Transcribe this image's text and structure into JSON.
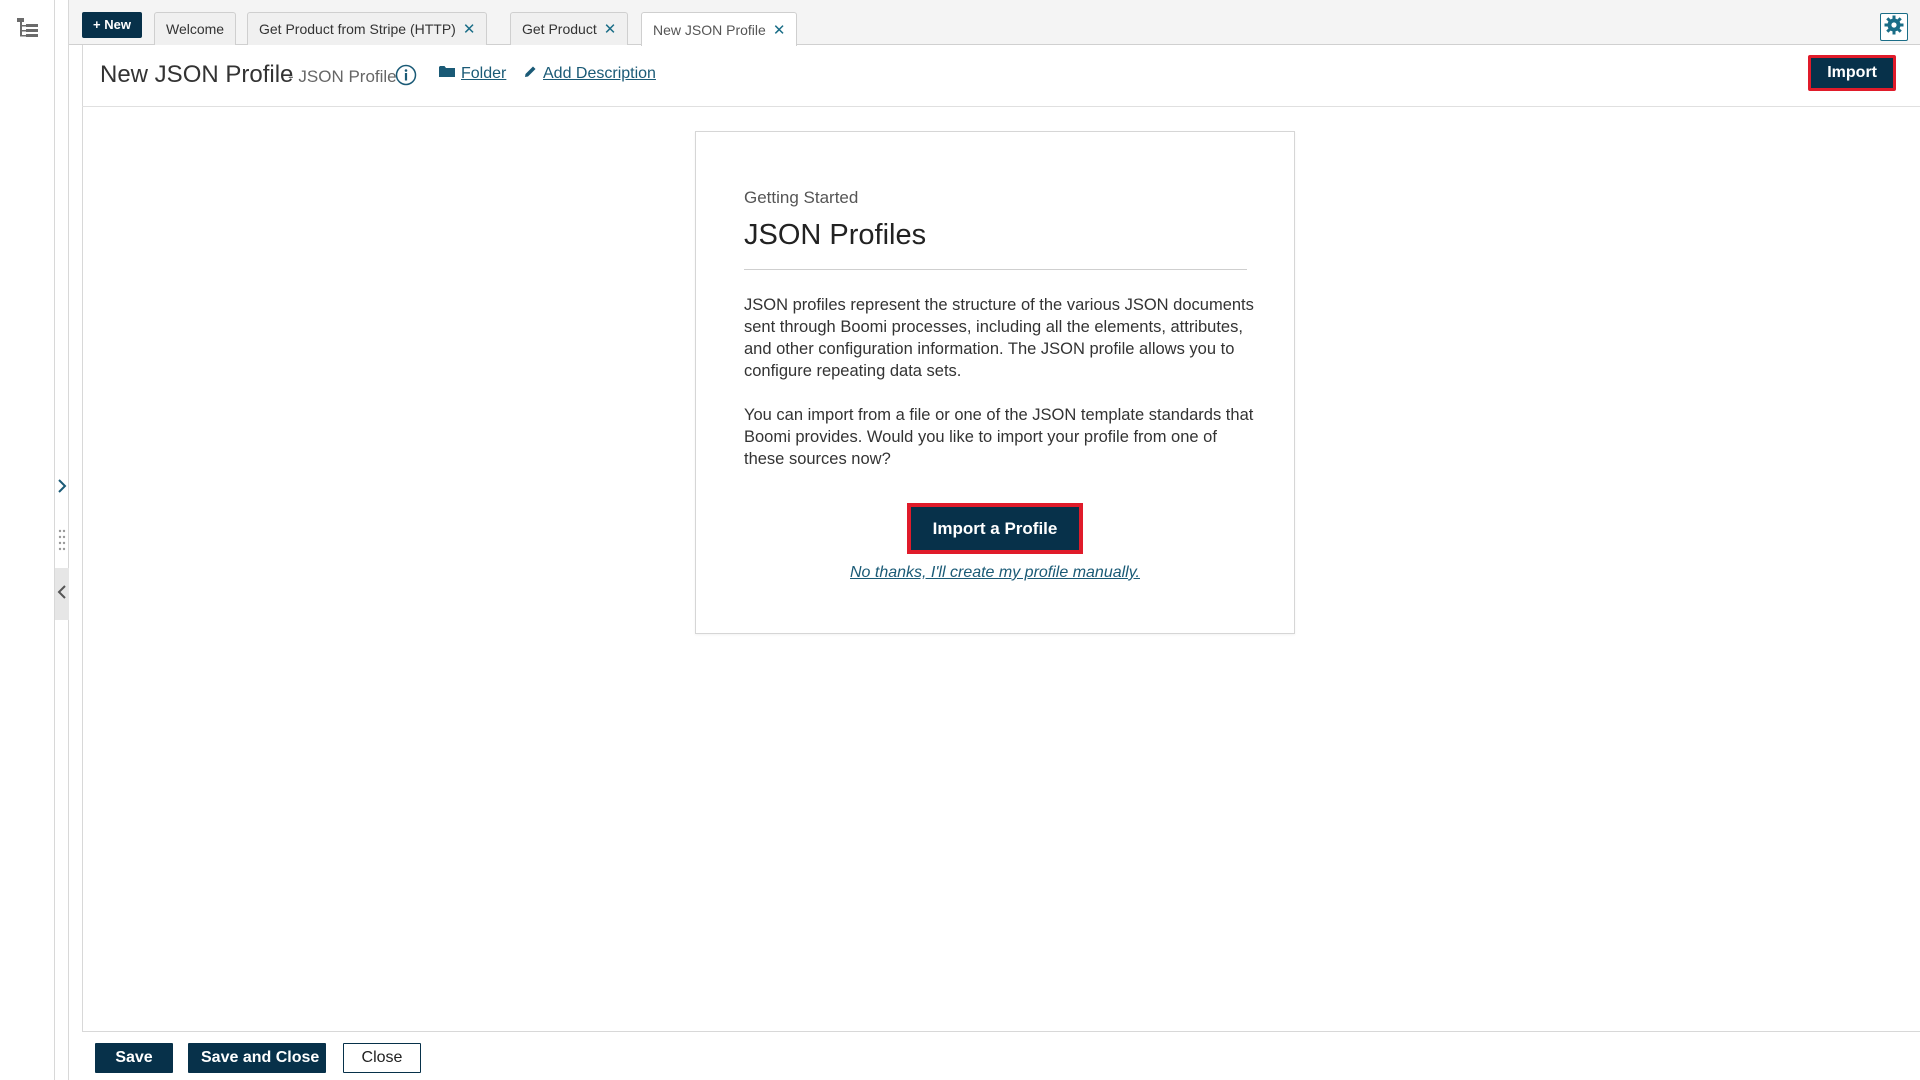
{
  "tabs": {
    "new_label": "+ New",
    "items": [
      {
        "label": "Welcome",
        "closable": false
      },
      {
        "label": "Get Product from Stripe (HTTP)",
        "closable": true
      },
      {
        "label": "Get Product",
        "closable": true
      },
      {
        "label": "New JSON Profile",
        "closable": true,
        "active": true
      }
    ],
    "close_glyph": "✕"
  },
  "header": {
    "title": "New JSON Profile",
    "subtitle": "- JSON Profile",
    "folder_link": "Folder",
    "description_link": "Add Description",
    "import_button": "Import"
  },
  "card": {
    "kicker": "Getting Started",
    "heading": "JSON Profiles",
    "paragraph1": "JSON profiles represent the structure of the various JSON documents sent through Boomi processes, including all the elements, attributes, and other configuration information. The JSON profile allows you to configure repeating data sets.",
    "paragraph2": "You can import from a file or one of the JSON template standards that Boomi provides. Would you like to import your profile from one of these sources now?",
    "import_profile_button": "Import a Profile",
    "manual_link": "No thanks, I'll create my profile manually."
  },
  "footer": {
    "save": "Save",
    "save_and_close": "Save and Close",
    "close": "Close"
  },
  "icons": {
    "tree": "tree-icon",
    "settings": "gear-icon",
    "info": "info-icon",
    "folder": "folder-icon",
    "pencil": "pencil-icon"
  },
  "colors": {
    "primary": "#07314a",
    "link": "#1a5a76",
    "highlight": "#e01b2a"
  }
}
